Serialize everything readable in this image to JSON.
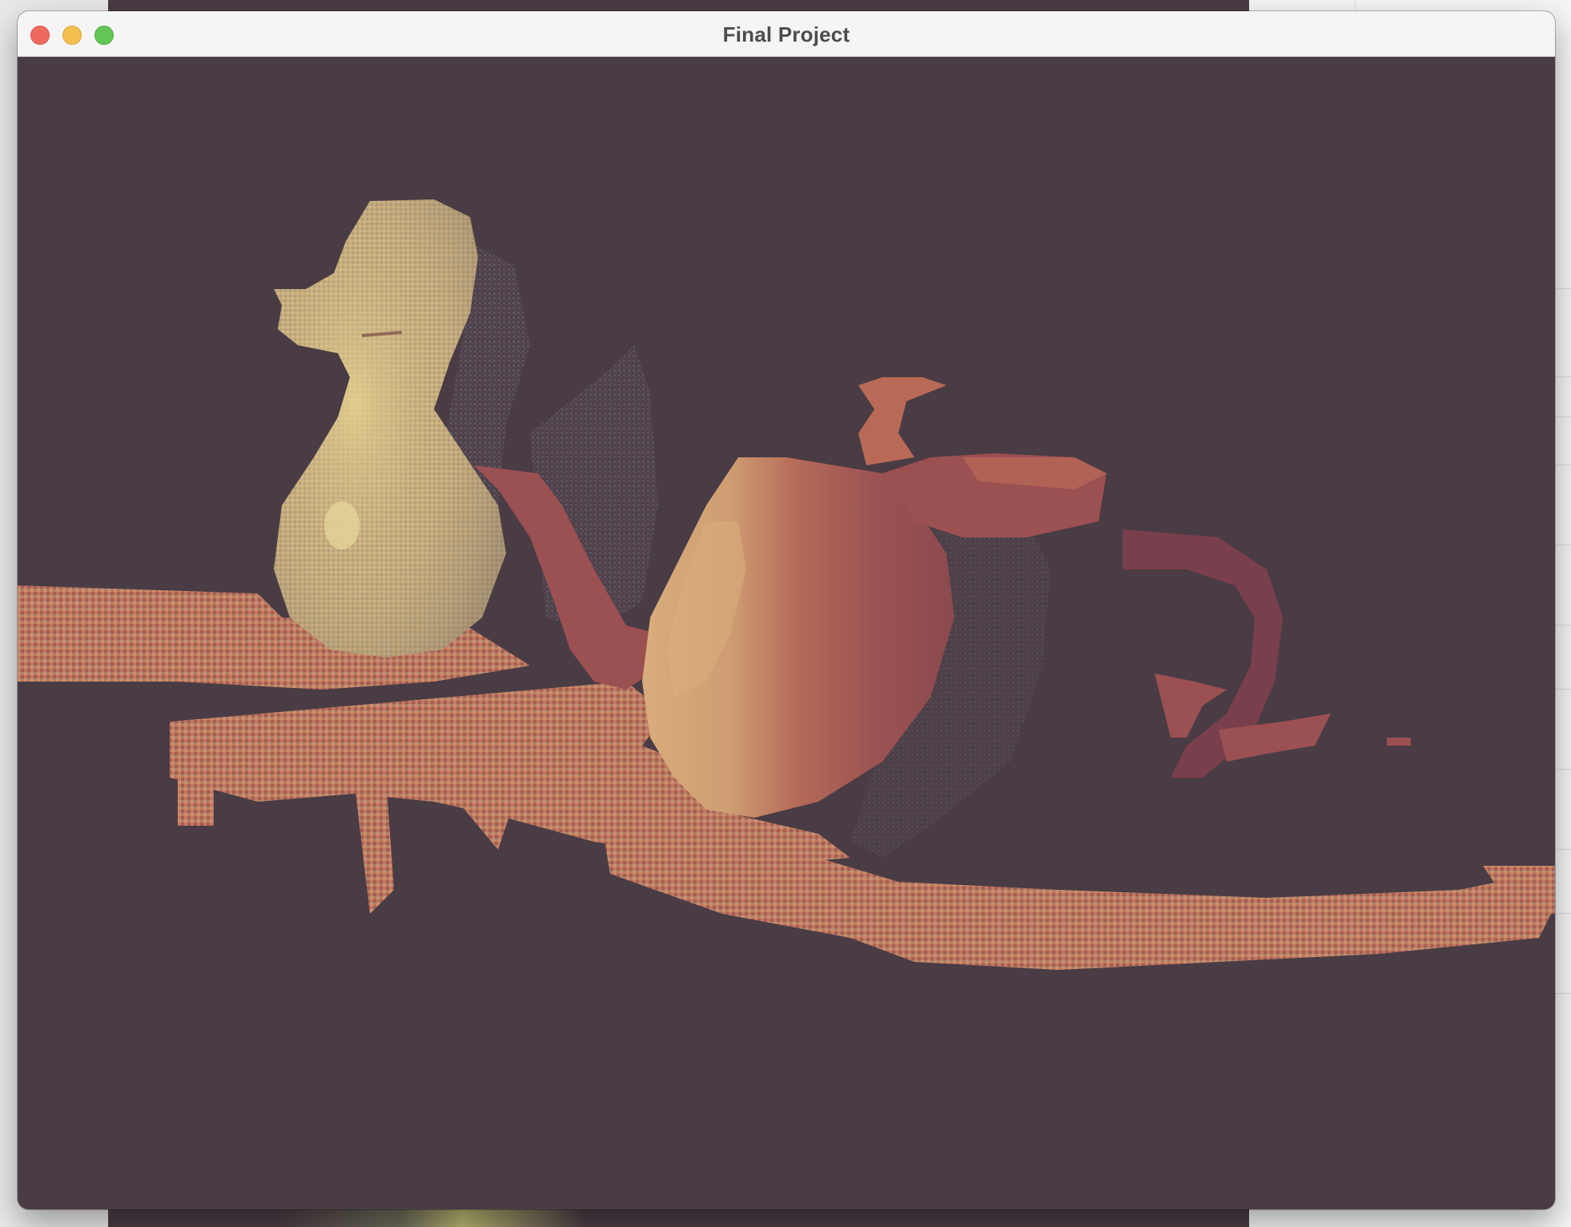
{
  "window": {
    "title": "Final Project",
    "controls": {
      "close": "close-button",
      "minimize": "minimize-button",
      "zoom": "zoom-button"
    }
  },
  "scene": {
    "background_color": "#4a3c44",
    "palette": [
      "#4a3c44",
      "#5c4b57",
      "#7a3f4c",
      "#9b5052",
      "#b96a56",
      "#cc8466",
      "#d9a87a",
      "#c9b27e",
      "#e1c888",
      "#55646e"
    ]
  }
}
